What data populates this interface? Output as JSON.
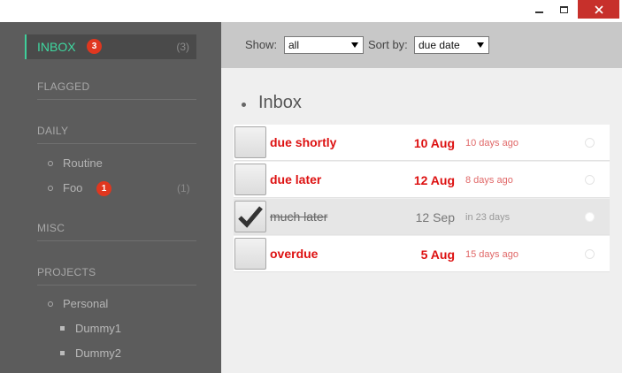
{
  "window": {
    "controls": {
      "minimize_icon": "minimize-icon",
      "maximize_icon": "maximize-icon",
      "close_icon": "close-icon"
    },
    "close_color": "#c7302b"
  },
  "sidebar": {
    "inbox": {
      "label": "INBOX",
      "badge": "3",
      "count": "(3)",
      "accent": "#3fd8a0"
    },
    "sections": [
      {
        "label": "FLAGGED"
      },
      {
        "label": "DAILY"
      },
      {
        "label": "MISC"
      },
      {
        "label": "PROJECTS"
      }
    ],
    "daily_items": [
      {
        "label": "Routine"
      },
      {
        "label": "Foo",
        "badge": "1",
        "count": "(1)"
      }
    ],
    "projects": [
      {
        "label": "Personal",
        "children": [
          {
            "label": "Dummy1"
          },
          {
            "label": "Dummy2"
          }
        ]
      }
    ]
  },
  "toolbar": {
    "show_label": "Show:",
    "show_value": "all",
    "sort_label": "Sort by:",
    "sort_value": "due date"
  },
  "main": {
    "heading": "Inbox",
    "tasks": [
      {
        "title": "due shortly",
        "due": "10 Aug",
        "relative": "10 days ago",
        "done": false
      },
      {
        "title": "due later",
        "due": "12 Aug",
        "relative": "8 days ago",
        "done": false
      },
      {
        "title": "much later",
        "due": "12 Sep",
        "relative": "in 23 days",
        "done": true
      },
      {
        "title": "overdue",
        "due": "5 Aug",
        "relative": "15 days ago",
        "done": false
      }
    ]
  },
  "colors": {
    "badge": "#e0371f",
    "overdue": "#dd1111",
    "sidebar_bg": "#5c5c5c"
  }
}
